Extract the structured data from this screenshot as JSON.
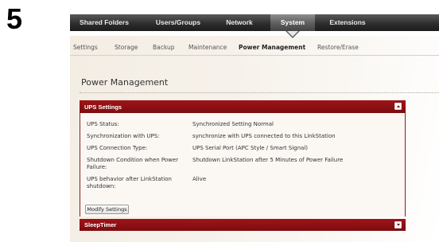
{
  "step_number": "5",
  "top_nav": {
    "tabs": [
      {
        "label": "Shared Folders"
      },
      {
        "label": "Users/Groups"
      },
      {
        "label": "Network"
      },
      {
        "label": "System",
        "active": true
      },
      {
        "label": "Extensions"
      }
    ]
  },
  "sub_nav": {
    "items": [
      {
        "label": "Settings"
      },
      {
        "label": "Storage"
      },
      {
        "label": "Backup"
      },
      {
        "label": "Maintenance"
      },
      {
        "label": "Power Management",
        "active": true
      },
      {
        "label": "Restore/Erase"
      }
    ]
  },
  "page_title": "Power Management",
  "ups_panel": {
    "title": "UPS Settings",
    "toggle_icon": "collapse-up-icon",
    "rows": [
      {
        "label": "UPS Status:",
        "value": "Synchronized Setting Normal"
      },
      {
        "label": "Synchronization with UPS:",
        "value": "synchronize with UPS connected to this LinkStation"
      },
      {
        "label": "UPS Connection Type:",
        "value": "UPS Serial Port (APC Style / Smart Signal)"
      },
      {
        "label": "Shutdown Condition when Power Failure:",
        "value": "Shutdown LinkStation after 5 Minutes of Power Failure"
      },
      {
        "label": "UPS behavior after LinkStation shutdown:",
        "value": "Alive"
      }
    ],
    "modify_button": "Modify Settings"
  },
  "sleep_panel": {
    "title": "SleepTimer",
    "toggle_icon": "expand-down-icon"
  },
  "colors": {
    "panel_header": "#8b1a1d",
    "nav_bar": "#2e2e2e",
    "nav_active": "#5d5d5d"
  }
}
